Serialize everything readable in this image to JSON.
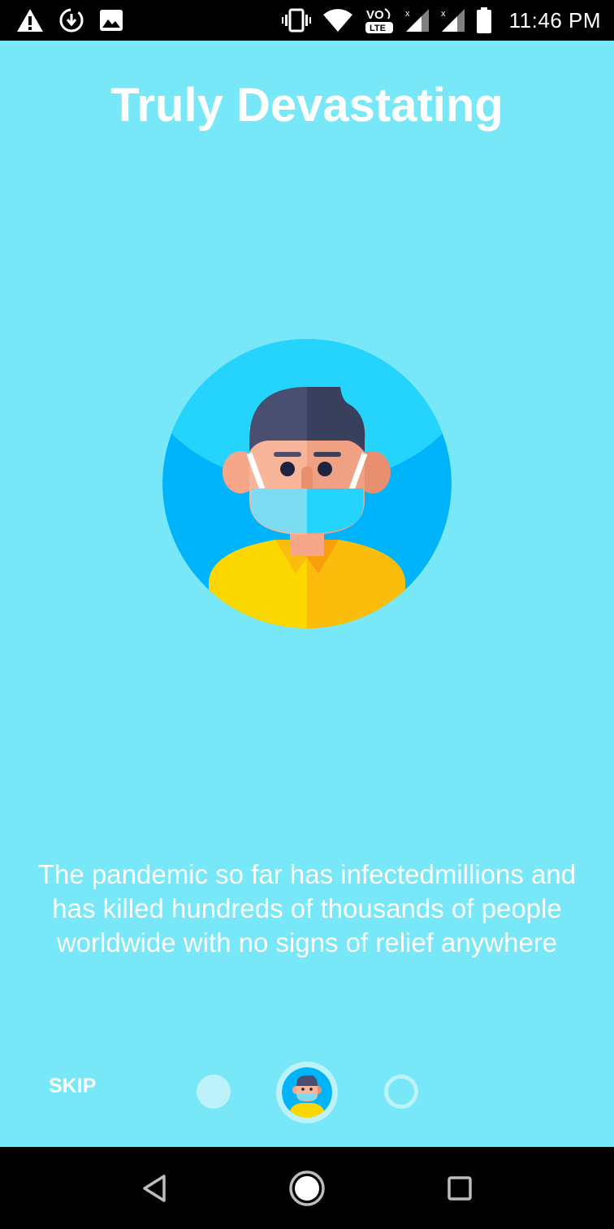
{
  "status_bar": {
    "time": "11:46 PM",
    "network_label": "VO LTE",
    "left_icons": [
      "warning-icon",
      "download-sync-icon",
      "image-icon"
    ],
    "right_icons": [
      "vibrate-icon",
      "wifi-icon",
      "volte-icon",
      "signal-1-icon",
      "signal-2-icon",
      "battery-icon"
    ]
  },
  "onboarding": {
    "title": "Truly Devastating",
    "illustration": "masked-person-illustration",
    "description": "The pandemic so far has infectedmillions and has killed hundreds of thousands of people worldwide with no signs of relief anywhere",
    "skip_label": "SKIP",
    "page_indicator": {
      "total_pages": 3,
      "current_page": 2
    }
  },
  "nav_bar": {
    "icons": [
      "back-icon",
      "home-icon",
      "recents-icon"
    ]
  },
  "colors": {
    "background": "#78e7f7",
    "text": "#ffffff",
    "indicator": "#bdf2fb",
    "bars": "#000000"
  }
}
